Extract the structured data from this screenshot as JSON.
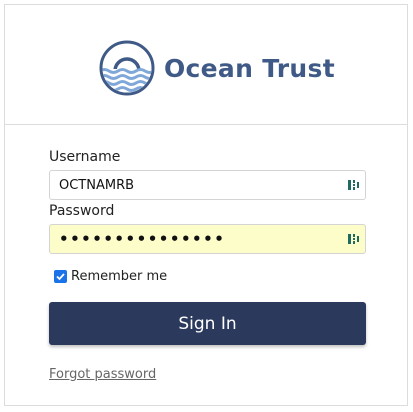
{
  "brand": {
    "name": "Ocean Trust",
    "logo_icon": "ocean-sun-waves-logo",
    "color": "#3f5a86"
  },
  "form": {
    "username_label": "Username",
    "username_value": "OCTNAMRB",
    "password_label": "Password",
    "password_value": "•••••••••••••••",
    "password_autofill_color": "#fcfdc9",
    "password_manager_icon": "password-manager-icon",
    "remember_label": "Remember me",
    "remember_checked": true,
    "submit_label": "Sign In",
    "submit_color": "#2b3a5c",
    "forgot_label": "Forgot password"
  }
}
